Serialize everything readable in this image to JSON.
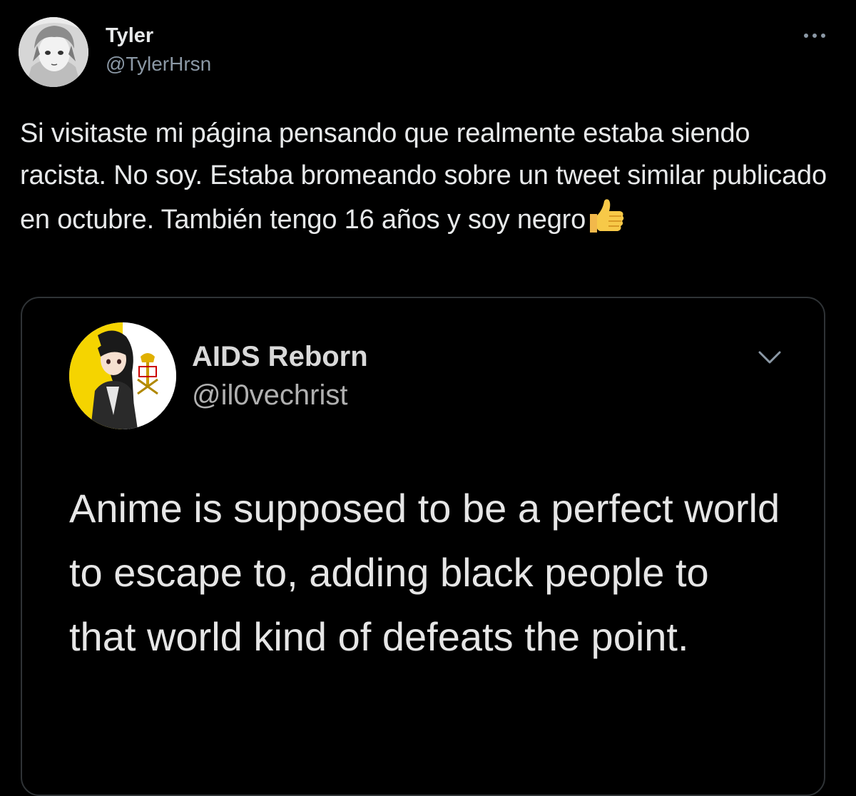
{
  "tweet": {
    "author_name": "Tyler",
    "author_handle": "@TylerHrsn",
    "avatar_icon": "manga-boy-avatar",
    "more_icon": "more-horizontal-icon",
    "text": "Si visitaste mi página pensando que realmente estaba siendo racista. No soy. Estaba bromeando sobre un tweet similar publicado en octubre. También tengo 16 años y soy negro",
    "emoji": "thumbs-up-emoji"
  },
  "quoted_tweet": {
    "author_name": "AIDS Reborn",
    "author_handle": "@il0vechrist",
    "avatar_icon": "anime-girl-vatican-flag-avatar",
    "chevron_icon": "chevron-down-icon",
    "text": "Anime is supposed to be a perfect world to escape to, adding black people to that world kind of defeats the point."
  },
  "colors": {
    "background": "#000000",
    "primary_text": "#e7e9ea",
    "secondary_text": "#8b98a5",
    "border": "#2f3336",
    "flag_yellow": "#f5d400"
  }
}
